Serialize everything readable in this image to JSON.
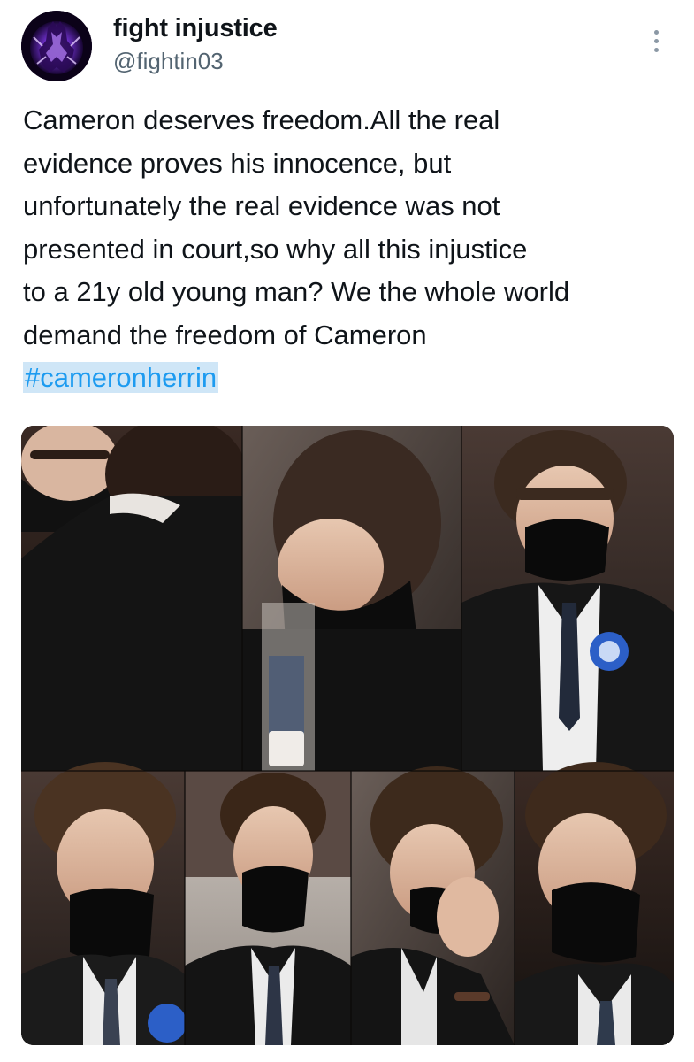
{
  "author": {
    "name": "fight injustice",
    "handle": "@fightin03",
    "avatar_icon": "purple-glowing-figure-avatar"
  },
  "menu": {
    "icon": "more-options-vertical-icon"
  },
  "tweet": {
    "lines": [
      "Cameron deserves freedom.All the real",
      "evidence proves his innocence, but",
      "unfortunately the real evidence was not",
      "presented in court,so why all this injustice",
      "to a 21y old young man? We the whole world",
      "demand the freedom of Cameron"
    ],
    "hashtag": "#cameronherrin",
    "hashtag_color": "#1d9bf0"
  },
  "media": {
    "layout": "collage of 7 courtroom photos",
    "subject": "young man in dark suit and black face mask"
  }
}
